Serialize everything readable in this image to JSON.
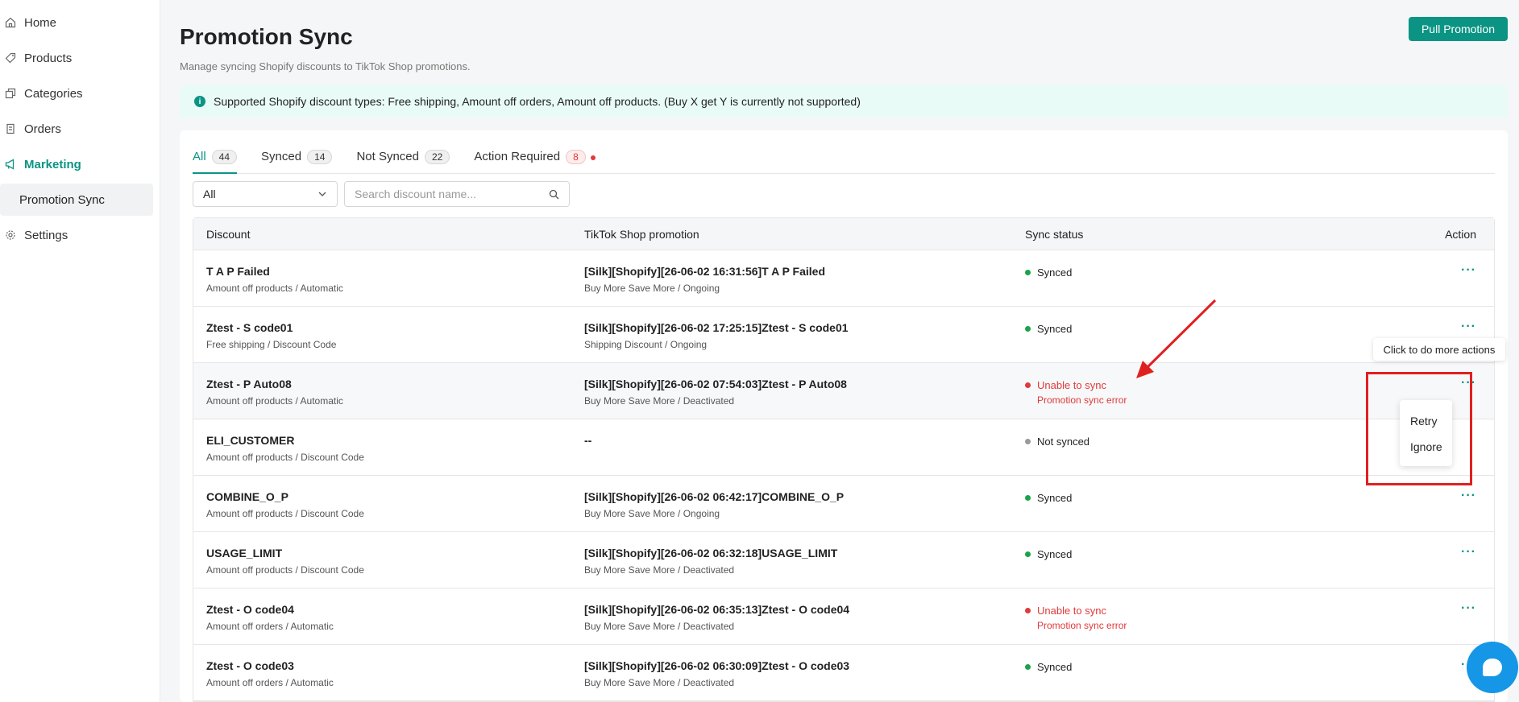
{
  "sidebar": {
    "items": [
      {
        "label": "Home"
      },
      {
        "label": "Products"
      },
      {
        "label": "Categories"
      },
      {
        "label": "Orders"
      },
      {
        "label": "Marketing"
      },
      {
        "label": "Promotion Sync"
      },
      {
        "label": "Settings"
      }
    ]
  },
  "header": {
    "title": "Promotion Sync",
    "subtitle": "Manage syncing Shopify discounts to TikTok Shop promotions.",
    "pull_button": "Pull Promotion"
  },
  "banner": {
    "text": "Supported Shopify discount types: Free shipping, Amount off orders, Amount off products. (Buy X get Y is currently not supported)"
  },
  "tabs": [
    {
      "label": "All",
      "count": "44"
    },
    {
      "label": "Synced",
      "count": "14"
    },
    {
      "label": "Not Synced",
      "count": "22"
    },
    {
      "label": "Action Required",
      "count": "8"
    }
  ],
  "filter": {
    "selected": "All"
  },
  "search": {
    "placeholder": "Search discount name..."
  },
  "table": {
    "headers": {
      "discount": "Discount",
      "promotion": "TikTok Shop promotion",
      "status": "Sync status",
      "action": "Action"
    },
    "rows": [
      {
        "name": "T A P Failed",
        "type": "Amount off products / Automatic",
        "promo": "[Silk][Shopify][26-06-02 16:31:56]T A P Failed",
        "promo_sub": "Buy More Save More / Ongoing",
        "status": "Synced",
        "status_sub": ""
      },
      {
        "name": "Ztest - S code01",
        "type": "Free shipping / Discount Code",
        "promo": "[Silk][Shopify][26-06-02 17:25:15]Ztest - S code01",
        "promo_sub": "Shipping Discount / Ongoing",
        "status": "Synced",
        "status_sub": ""
      },
      {
        "name": "Ztest - P Auto08",
        "type": "Amount off products / Automatic",
        "promo": "[Silk][Shopify][26-06-02 07:54:03]Ztest - P Auto08",
        "promo_sub": "Buy More Save More / Deactivated",
        "status": "Unable to sync",
        "status_sub": "Promotion sync error"
      },
      {
        "name": "ELI_CUSTOMER",
        "type": "Amount off products / Discount Code",
        "promo": "--",
        "promo_sub": "",
        "status": "Not synced",
        "status_sub": ""
      },
      {
        "name": "COMBINE_O_P",
        "type": "Amount off products / Discount Code",
        "promo": "[Silk][Shopify][26-06-02 06:42:17]COMBINE_O_P",
        "promo_sub": "Buy More Save More / Ongoing",
        "status": "Synced",
        "status_sub": ""
      },
      {
        "name": "USAGE_LIMIT",
        "type": "Amount off products / Discount Code",
        "promo": "[Silk][Shopify][26-06-02 06:32:18]USAGE_LIMIT",
        "promo_sub": "Buy More Save More / Deactivated",
        "status": "Synced",
        "status_sub": ""
      },
      {
        "name": "Ztest - O code04",
        "type": "Amount off orders / Automatic",
        "promo": "[Silk][Shopify][26-06-02 06:35:13]Ztest - O code04",
        "promo_sub": "Buy More Save More / Deactivated",
        "status": "Unable to sync",
        "status_sub": "Promotion sync error"
      },
      {
        "name": "Ztest - O code03",
        "type": "Amount off orders / Automatic",
        "promo": "[Silk][Shopify][26-06-02 06:30:09]Ztest - O code03",
        "promo_sub": "Buy More Save More / Deactivated",
        "status": "Synced",
        "status_sub": ""
      }
    ]
  },
  "more_icon": "···",
  "tooltip": "Click to do more actions",
  "dropdown": {
    "items": [
      "Retry",
      "Ignore"
    ]
  },
  "colors": {
    "accent": "#0b9484",
    "error": "#e03a3a",
    "success": "#1aa34a",
    "annotation": "#e02020",
    "chat": "#1596e6"
  }
}
